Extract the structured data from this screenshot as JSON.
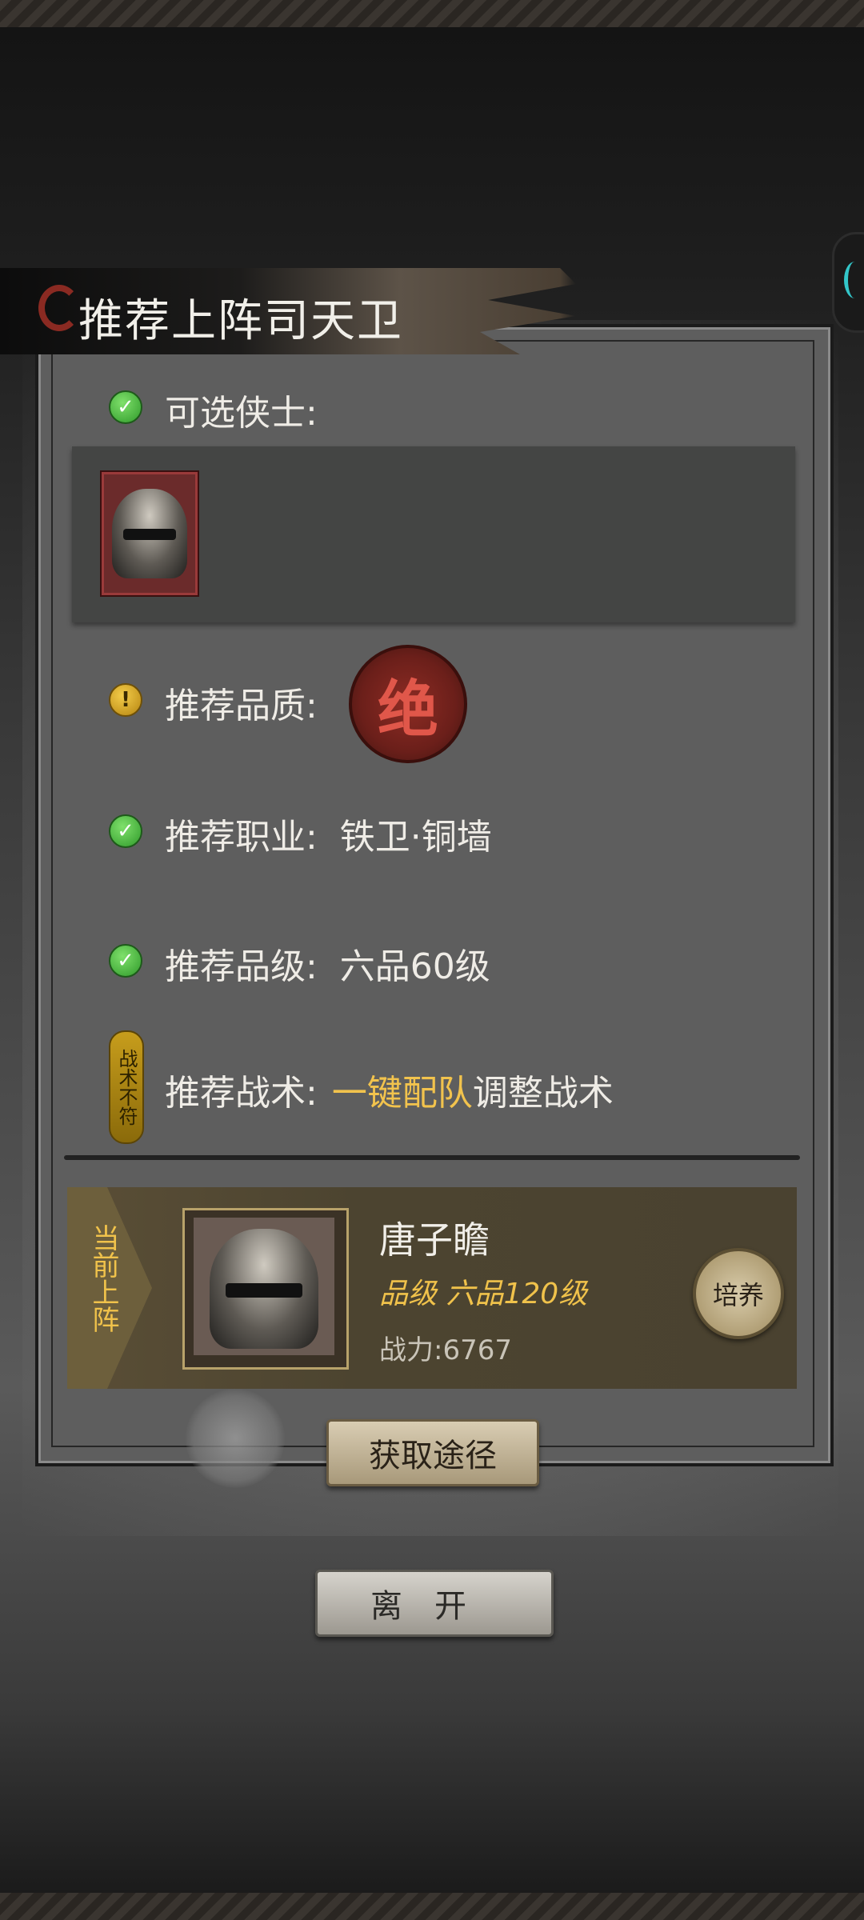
{
  "dialog": {
    "title": "推荐上阵司天卫"
  },
  "requirements": {
    "eligible_heroes_label": "可选侠士:",
    "quality_label": "推荐品质:",
    "quality_seal": "绝",
    "profession": "推荐职业:  铁卫·铜墙",
    "rank": "推荐品级:  六品60级",
    "tactics_label": "推荐战术:",
    "tactics_link": "一键配队",
    "tactics_suffix": "调整战术",
    "tactics_status_badge": "战术不符"
  },
  "current_lineup": {
    "tag": "当前上阵",
    "hero_name": "唐子瞻",
    "hero_grade": "品级 六品120级",
    "hero_power": "战力:6767",
    "train_label": "培养"
  },
  "buttons": {
    "acquire": "获取途径",
    "leave": "离开"
  },
  "colors": {
    "accent_gold": "#f2c34d",
    "ok_green": "#2f9a2a",
    "seal_red": "#8e2c24",
    "panel_gray": "#5e5e5e"
  }
}
